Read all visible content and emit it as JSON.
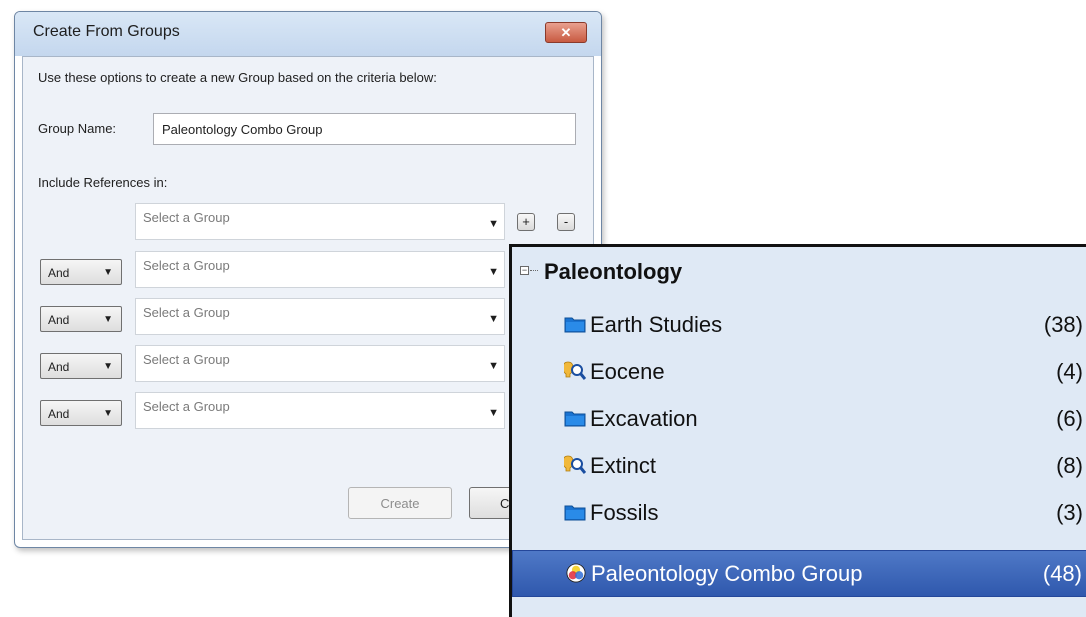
{
  "dialog": {
    "title": "Create From Groups",
    "close_label": "✕",
    "instructions": "Use these options to create a new Group based on the criteria below:",
    "group_name_label": "Group Name:",
    "group_name_value": "Paleontology Combo Group",
    "include_label": "Include References in:",
    "add_label": "+",
    "remove_label": "-",
    "rows": [
      {
        "operator": "",
        "group": "Select a Group"
      },
      {
        "operator": "And",
        "group": "Select a Group"
      },
      {
        "operator": "And",
        "group": "Select a Group"
      },
      {
        "operator": "And",
        "group": "Select a Group"
      },
      {
        "operator": "And",
        "group": "Select a Group"
      }
    ],
    "create_label": "Create",
    "cancel_label": "Cancel"
  },
  "tree": {
    "title": "Paleontology",
    "expander": "−",
    "items": [
      {
        "label": "Earth Studies",
        "count": "(38)",
        "icon": "folder-icon"
      },
      {
        "label": "Eocene",
        "count": "(4)",
        "icon": "smart-group-icon"
      },
      {
        "label": "Excavation",
        "count": "(6)",
        "icon": "folder-icon"
      },
      {
        "label": "Extinct",
        "count": "(8)",
        "icon": "smart-group-icon"
      },
      {
        "label": "Fossils",
        "count": "(3)",
        "icon": "folder-icon"
      },
      {
        "label": "Paleontology Combo Group",
        "count": "(48)",
        "icon": "combo-group-icon"
      }
    ]
  },
  "colors": {
    "selection": "#3a64b8",
    "panel_background": "#dfe9f5",
    "folder_blue": "#1a73d1"
  }
}
